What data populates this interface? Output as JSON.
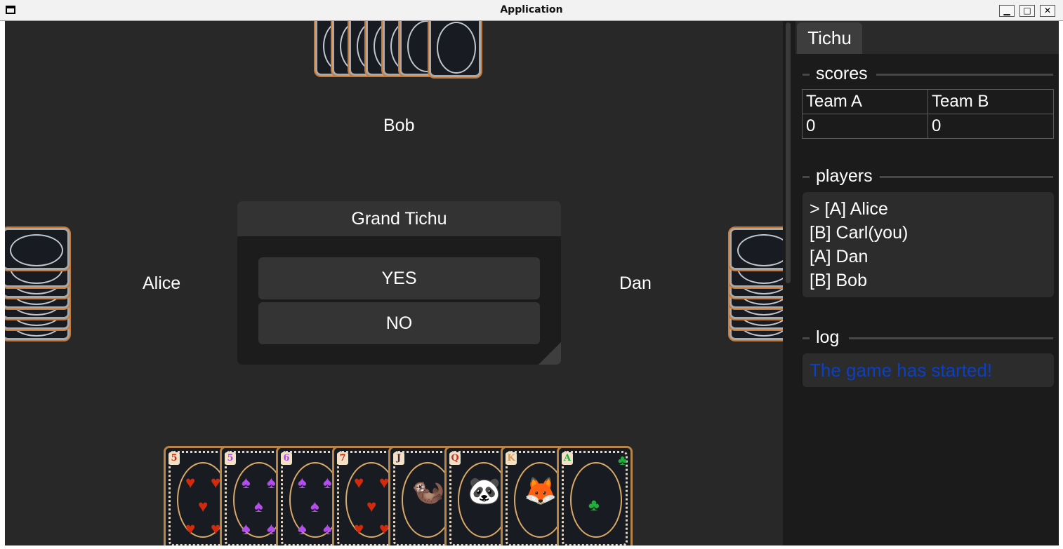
{
  "window": {
    "title": "Application",
    "minimize_glyph": "▁",
    "maximize_glyph": "□",
    "close_glyph": "✕"
  },
  "sidebar": {
    "tab_label": "Tichu",
    "scores": {
      "label": "scores",
      "headers": [
        "Team A",
        "Team B"
      ],
      "values": [
        "0",
        "0"
      ]
    },
    "players": {
      "label": "players",
      "items": [
        "> [A] Alice",
        "[B] Carl(you)",
        "[A] Dan",
        "[B] Bob"
      ]
    },
    "log": {
      "label": "log",
      "entries": [
        "The game has started!"
      ],
      "color": "#0b3fc4"
    }
  },
  "table": {
    "top_player": "Bob",
    "left_player": "Alice",
    "right_player": "Dan"
  },
  "dialog": {
    "title": "Grand Tichu",
    "yes_label": "YES",
    "no_label": "NO"
  },
  "hand": [
    {
      "rank": "5",
      "suit": "heart",
      "color": "#d32a0e"
    },
    {
      "rank": "5",
      "suit": "spade",
      "color": "#b44cf0"
    },
    {
      "rank": "6",
      "suit": "spade",
      "color": "#b44cf0"
    },
    {
      "rank": "7",
      "suit": "heart",
      "color": "#d32a0e"
    },
    {
      "rank": "J",
      "suit": "otter",
      "color": "#4a2a3a"
    },
    {
      "rank": "Q",
      "suit": "red-panda",
      "color": "#c0392b"
    },
    {
      "rank": "K",
      "suit": "fox",
      "color": "#d49a5a"
    },
    {
      "rank": "A",
      "suit": "club",
      "color": "#1fae3a"
    }
  ],
  "colors": {
    "table_bg": "#282828",
    "sidebar_bg": "#1b1b1b",
    "card_border": "#b88548"
  }
}
